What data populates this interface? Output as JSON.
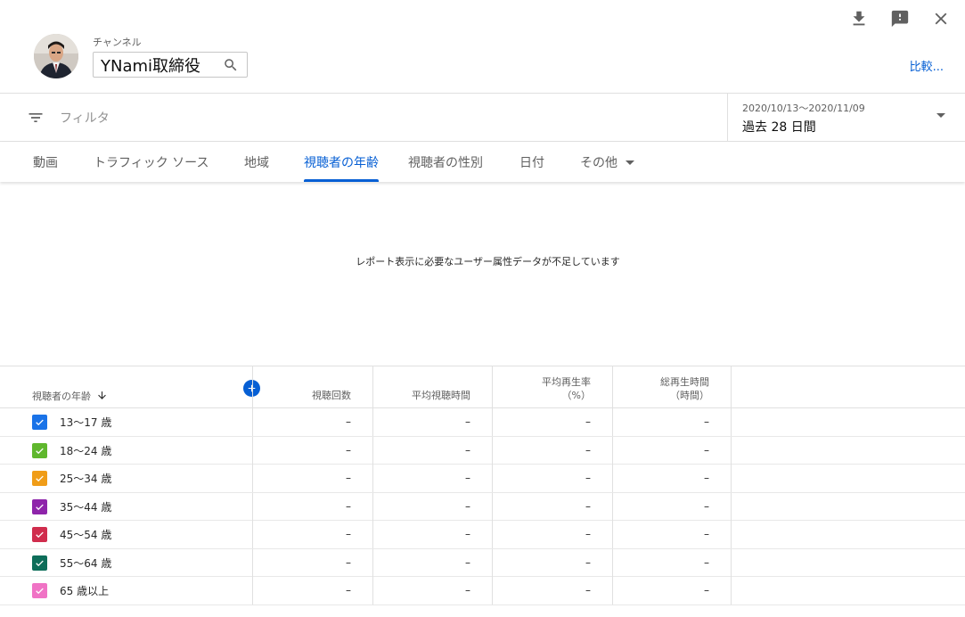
{
  "header": {
    "channel_label": "チャンネル",
    "channel_name": "YNami取締役",
    "compare_label": "比較...",
    "icons": [
      "download-icon",
      "feedback-icon",
      "close-icon"
    ]
  },
  "filter": {
    "placeholder": "フィルタ",
    "date_range": "2020/10/13〜2020/11/09",
    "date_preset": "過去 28 日間"
  },
  "tabs": [
    {
      "label": "動画"
    },
    {
      "label": "トラフィック ソース"
    },
    {
      "label": "地域"
    },
    {
      "label": "視聴者の年齢",
      "active": true
    },
    {
      "label": "視聴者の性別"
    },
    {
      "label": "日付"
    },
    {
      "label": "その他"
    }
  ],
  "notice": "レポート表示に必要なユーザー属性データが不足しています",
  "table": {
    "dimension_header": "視聴者の年齢",
    "columns": [
      {
        "line1": "",
        "line2": "視聴回数"
      },
      {
        "line1": "",
        "line2": "平均視聴時間"
      },
      {
        "line1": "平均再生率",
        "line2": "（%）"
      },
      {
        "line1": "総再生時間",
        "line2": "（時間）"
      }
    ],
    "rows": [
      {
        "label": "13〜17 歳",
        "color": "#1a73e8",
        "values": [
          "–",
          "–",
          "–",
          "–"
        ]
      },
      {
        "label": "18〜24 歳",
        "color": "#5fb72d",
        "values": [
          "–",
          "–",
          "–",
          "–"
        ]
      },
      {
        "label": "25〜34 歳",
        "color": "#f09d18",
        "values": [
          "–",
          "–",
          "–",
          "–"
        ]
      },
      {
        "label": "35〜44 歳",
        "color": "#8e24aa",
        "values": [
          "–",
          "–",
          "–",
          "–"
        ]
      },
      {
        "label": "45〜54 歳",
        "color": "#d02d4d",
        "values": [
          "–",
          "–",
          "–",
          "–"
        ]
      },
      {
        "label": "55〜64 歳",
        "color": "#0e6e5a",
        "values": [
          "–",
          "–",
          "–",
          "–"
        ]
      },
      {
        "label": "65 歳以上",
        "color": "#f073c5",
        "values": [
          "–",
          "–",
          "–",
          "–"
        ]
      }
    ]
  }
}
